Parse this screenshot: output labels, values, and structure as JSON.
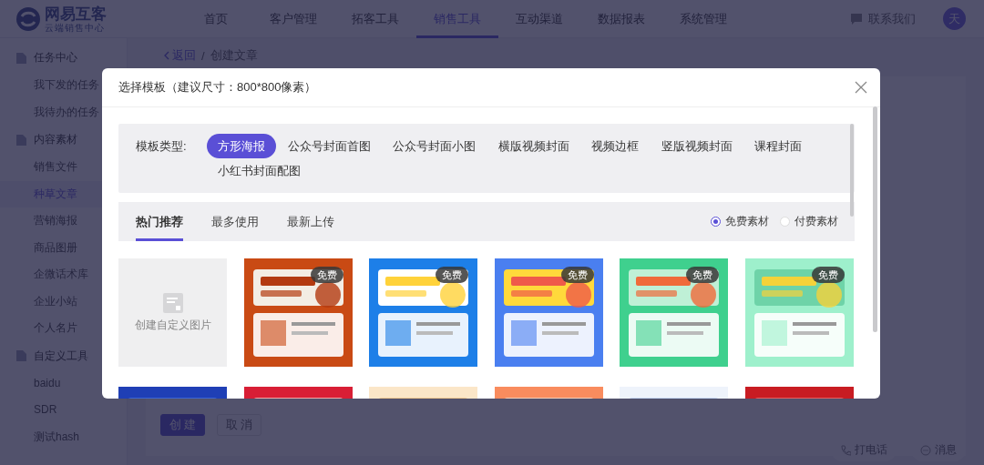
{
  "app": {
    "logo": {
      "name": "网易互客",
      "subtitle": "云端销售中心"
    },
    "nav": [
      {
        "label": "首页",
        "selected": false
      },
      {
        "label": "客户管理",
        "selected": false
      },
      {
        "label": "拓客工具",
        "selected": false
      },
      {
        "label": "销售工具",
        "selected": true
      },
      {
        "label": "互动渠道",
        "selected": false
      },
      {
        "label": "数据报表",
        "selected": false
      },
      {
        "label": "系统管理",
        "selected": false
      }
    ],
    "contact": "联系我们",
    "avatar": "天",
    "sidebar": [
      {
        "label": "任务中心",
        "children": [
          {
            "label": "我下发的任务",
            "selected": false
          },
          {
            "label": "我待办的任务",
            "selected": false
          }
        ]
      },
      {
        "label": "内容素材",
        "children": [
          {
            "label": "销售文件",
            "selected": false
          },
          {
            "label": "种草文章",
            "selected": true
          },
          {
            "label": "营销海报",
            "selected": false
          },
          {
            "label": "商品图册",
            "selected": false
          },
          {
            "label": "企微话术库",
            "selected": false
          },
          {
            "label": "企业小站",
            "selected": false
          },
          {
            "label": "个人名片",
            "selected": false
          }
        ]
      },
      {
        "label": "自定义工具",
        "children": [
          {
            "label": "baidu",
            "selected": false
          },
          {
            "label": "SDR",
            "selected": false
          },
          {
            "label": "测试hash",
            "selected": false
          }
        ]
      }
    ],
    "breadcrumb": {
      "back": "返回",
      "separator": "/",
      "current": "创建文章"
    },
    "form_buttons": [
      {
        "label": "创 建",
        "kind": "primary"
      },
      {
        "label": "取 消",
        "kind": "default"
      }
    ],
    "float_buttons": [
      {
        "label": "打电话",
        "kind": "phone"
      },
      {
        "label": "消息",
        "kind": "chat"
      }
    ]
  },
  "modal": {
    "title": "选择模板（建议尺寸：800*800像素）",
    "type_label": "模板类型:",
    "types": [
      {
        "label": "方形海报",
        "selected": true
      },
      {
        "label": "公众号封面首图",
        "selected": false
      },
      {
        "label": "公众号封面小图",
        "selected": false
      },
      {
        "label": "横版视频封面",
        "selected": false
      },
      {
        "label": "视频边框",
        "selected": false
      },
      {
        "label": "竖版视频封面",
        "selected": false
      },
      {
        "label": "课程封面",
        "selected": false
      },
      {
        "label": "小红书封面配图",
        "selected": false
      }
    ],
    "sort_tabs": [
      {
        "label": "热门推荐",
        "selected": true
      },
      {
        "label": "最多使用",
        "selected": false
      },
      {
        "label": "最新上传",
        "selected": false
      }
    ],
    "price_filter": [
      {
        "label": "免费素材",
        "selected": true
      },
      {
        "label": "付费素材",
        "selected": false
      }
    ],
    "tiles": [
      {
        "kind": "custom",
        "label": "创建自定义图片"
      },
      {
        "kind": "picture",
        "badge": "免费"
      },
      {
        "kind": "picture",
        "badge": "免费"
      },
      {
        "kind": "picture",
        "badge": "免费"
      },
      {
        "kind": "picture",
        "badge": "免费"
      },
      {
        "kind": "picture",
        "badge": "免费"
      },
      {
        "kind": "picture"
      },
      {
        "kind": "picture"
      },
      {
        "kind": "picture"
      },
      {
        "kind": "picture"
      },
      {
        "kind": "picture"
      },
      {
        "kind": "picture"
      }
    ]
  }
}
